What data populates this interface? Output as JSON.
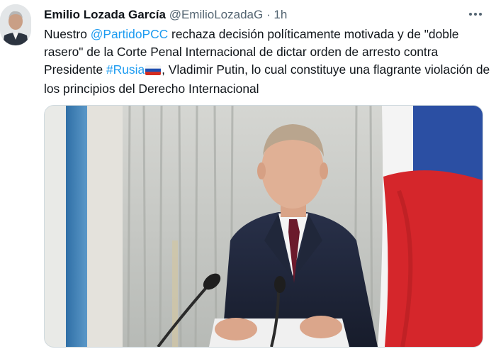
{
  "tweet": {
    "author": {
      "display_name": "Emilio Lozada García",
      "handle": "@EmilioLozadaG",
      "separator": "·",
      "time": "1h"
    },
    "more_icon": "more-horizontal-icon",
    "text": {
      "part1": "Nuestro ",
      "mention": "@PartidoPCC",
      "part2": " rechaza decisión políticamente motivada y de \"doble rasero\" de la Corte Penal Internacional de dictar orden de arresto contra Presidente ",
      "hashtag": "#Rusia",
      "flag_icon": "russia-flag-icon",
      "part3": ", Vladimir Putin, lo cual constituye una flagrante violación de los principios del Derecho Internacional"
    },
    "media": {
      "type": "photo",
      "colors": {
        "curtain": "#c7c9c6",
        "suit": "#1c2233",
        "flag_white": "#f4f4f4",
        "flag_blue": "#2b4fa3",
        "flag_red": "#d5262b"
      }
    }
  },
  "colors": {
    "link": "#1d9bf0",
    "text": "#0f1419",
    "secondary": "#536471"
  }
}
